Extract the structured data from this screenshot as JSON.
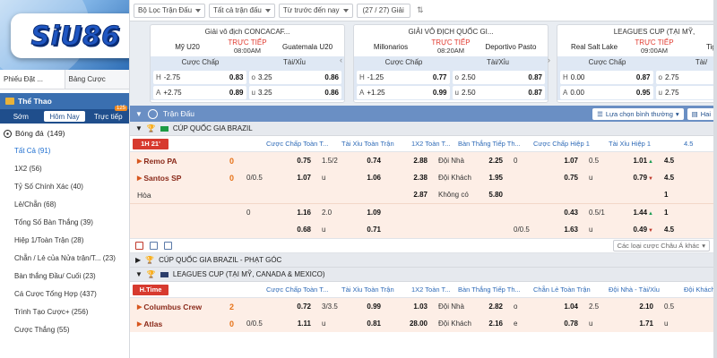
{
  "brand": {
    "logo_text": "SiU86"
  },
  "left": {
    "tabs": [
      "Phiếu Đặt ...",
      "Bảng Cược"
    ],
    "sport_title": "Thể Thao",
    "time_tabs": [
      {
        "label": "Sớm",
        "badge": ""
      },
      {
        "label": "Hôm Nay",
        "badge": ""
      },
      {
        "label": "Trực tiếp",
        "badge": "125"
      }
    ],
    "sport_item": "Bóng đá",
    "sport_count": "(149)",
    "menu": [
      "Tất Cả (91)",
      "1X2 (56)",
      "Tỷ Số Chính Xác (40)",
      "Lẻ/Chẵn (68)",
      "Tổng Số Bàn Thắng (39)",
      "Hiệp 1/Toàn Trận (28)",
      "Chẵn / Lẻ của Nửa trận/T... (23)",
      "Bàn thắng Đầu/ Cuối (23)",
      "Cá Cược Tổng Hợp (437)",
      "Trình Tạo Cược+ (256)",
      "Cược Thắng (55)"
    ]
  },
  "topbar": {
    "filter_league": "Bộ Lọc Trận Đấu",
    "filter_all": "Tất cả trận đấu",
    "filter_sort": "Từ trước đến nay",
    "filter_count": "(27 / 27) Giải"
  },
  "featured": [
    {
      "league": "Giải vô địch CONCACAF...",
      "home": "Mỹ U20",
      "away": "Guatemala U20",
      "status": "TRỰC TIẾP",
      "time": "08:00AM",
      "head_handicap": "Cược Chấp",
      "head_ou": "Tài/Xỉu",
      "rows": [
        {
          "hl": "H",
          "hv": "-2.75",
          "ho": "0.83",
          "ol": "o",
          "ov": "3.25",
          "oo": "0.86"
        },
        {
          "hl": "A",
          "hv": "+2.75",
          "ho": "0.89",
          "ol": "u",
          "ov": "3.25",
          "oo": "0.86"
        }
      ]
    },
    {
      "league": "GIẢI VÔ ĐỊCH QUỐC GI...",
      "home": "Millonarios",
      "away": "Deportivo Pasto",
      "status": "TRỰC TIẾP",
      "time": "08:20AM",
      "head_handicap": "Cược Chấp",
      "head_ou": "Tài/Xỉu",
      "rows": [
        {
          "hl": "H",
          "hv": "-1.25",
          "ho": "0.77",
          "ol": "o",
          "ov": "2.50",
          "oo": "0.87"
        },
        {
          "hl": "A",
          "hv": "+1.25",
          "ho": "0.99",
          "ol": "u",
          "ov": "2.50",
          "oo": "0.87"
        }
      ]
    },
    {
      "league": "LEAGUES CUP (TẠI MỸ,",
      "home": "Real Salt Lake",
      "away": "Tigre",
      "status": "TRỰC TIẾP",
      "time": "09:00AM",
      "head_handicap": "Cược Chấp",
      "head_ou": "Tài/",
      "rows": [
        {
          "hl": "H",
          "hv": "0.00",
          "ho": "0.87",
          "ol": "o",
          "ov": "2.75",
          "oo": ""
        },
        {
          "hl": "A",
          "hv": "0.00",
          "ho": "0.95",
          "ol": "u",
          "ov": "2.75",
          "oo": ""
        }
      ]
    }
  ],
  "main": {
    "section_title": "Trận Đấu",
    "sort_label": "Lựa chọn bình thường",
    "hai_label": "Hai",
    "league1": "CÚP QUỐC GIA BRAZIL",
    "live_tag1": "1H 21'",
    "headers1": [
      "Cược Chấp Toàn T...",
      "Tài Xỉu Toàn Trận",
      "1X2 Toàn T...",
      "Bàn Thắng Tiếp Th...",
      "Cược Chấp Hiệp 1",
      "Tài Xỉu Hiệp 1",
      "4.5"
    ],
    "match1": {
      "home": "Remo PA",
      "away": "Santos SP",
      "draw": "Hòa",
      "home_score": "0",
      "away_score": "0",
      "row_home": {
        "hcp": "",
        "hcp_odds": "0.75",
        "ou": "1.5/2",
        "ou_odds": "0.74",
        "x12": "2.88",
        "next_lbl": "Đội Nhà",
        "next_val": "2.25",
        "h1hcp": "0",
        "h1hcp_odds": "1.07",
        "h1ou": "0.5",
        "h1ou_odds": "1.01",
        "extra": "4.5"
      },
      "row_away": {
        "hcp": "0/0.5",
        "hcp_odds": "1.07",
        "ou": "u",
        "ou_odds": "1.06",
        "x12": "2.38",
        "next_lbl": "Đội Khách",
        "next_val": "1.95",
        "h1hcp": "",
        "h1hcp_odds": "0.75",
        "h1ou": "u",
        "h1ou_odds": "0.79",
        "extra": "4.5"
      },
      "row_draw": {
        "x12": "2.87",
        "next_lbl": "Không có",
        "next_val": "5.80",
        "extra": "1"
      }
    },
    "alt1": {
      "row_a": {
        "hcp": "0",
        "hcp_odds": "1.16",
        "ou": "2.0",
        "ou_odds": "1.09",
        "h1hcp_odds": "0.43",
        "h1ou": "0.5/1",
        "h1ou_odds": "1.44",
        "extra": "1"
      },
      "row_b": {
        "hcp": "",
        "hcp_odds": "0.68",
        "ou": "u",
        "ou_odds": "0.71",
        "h1hcp": "0/0.5",
        "h1hcp_odds": "1.63",
        "h1ou": "u",
        "h1ou_odds": "0.49",
        "extra": "4.5"
      }
    },
    "odds_type": "Các loại cược Châu Á khác",
    "league2": "CÚP QUỐC GIA BRAZIL - PHẠT GÓC",
    "league3": "LEAGUES CUP (TẠI MỸ, CANADA & MEXICO)",
    "live_tag2": "H.Time",
    "headers2": [
      "Cược Chấp Toàn T...",
      "Tài Xỉu Toàn Trận",
      "1X2 Toàn T...",
      "Bàn Thắng Tiếp Th...",
      "Chẵn Lẻ Toàn Trận",
      "Đội Nhà - Tài/Xỉu",
      "Đội Khách"
    ],
    "match2": {
      "home": "Columbus Crew",
      "away": "Atlas",
      "home_score": "2",
      "away_score": "0",
      "row_home": {
        "hcp": "",
        "hcp_odds": "0.72",
        "ou": "3/3.5",
        "ou_odds": "0.99",
        "x12": "1.03",
        "next_lbl": "Đội Nhà",
        "next_val": "2.82",
        "oe": "o",
        "oe_odds": "1.04",
        "ht": "2.5",
        "ht_odds": "2.10",
        "extra": "0.5"
      },
      "row_away": {
        "hcp": "0/0.5",
        "hcp_odds": "1.11",
        "ou": "u",
        "ou_odds": "0.81",
        "x12": "28.00",
        "next_lbl": "Đội Khách",
        "next_val": "2.16",
        "oe": "e",
        "oe_odds": "0.78",
        "ht": "u",
        "ht_odds": "1.71",
        "extra": "u"
      }
    }
  }
}
